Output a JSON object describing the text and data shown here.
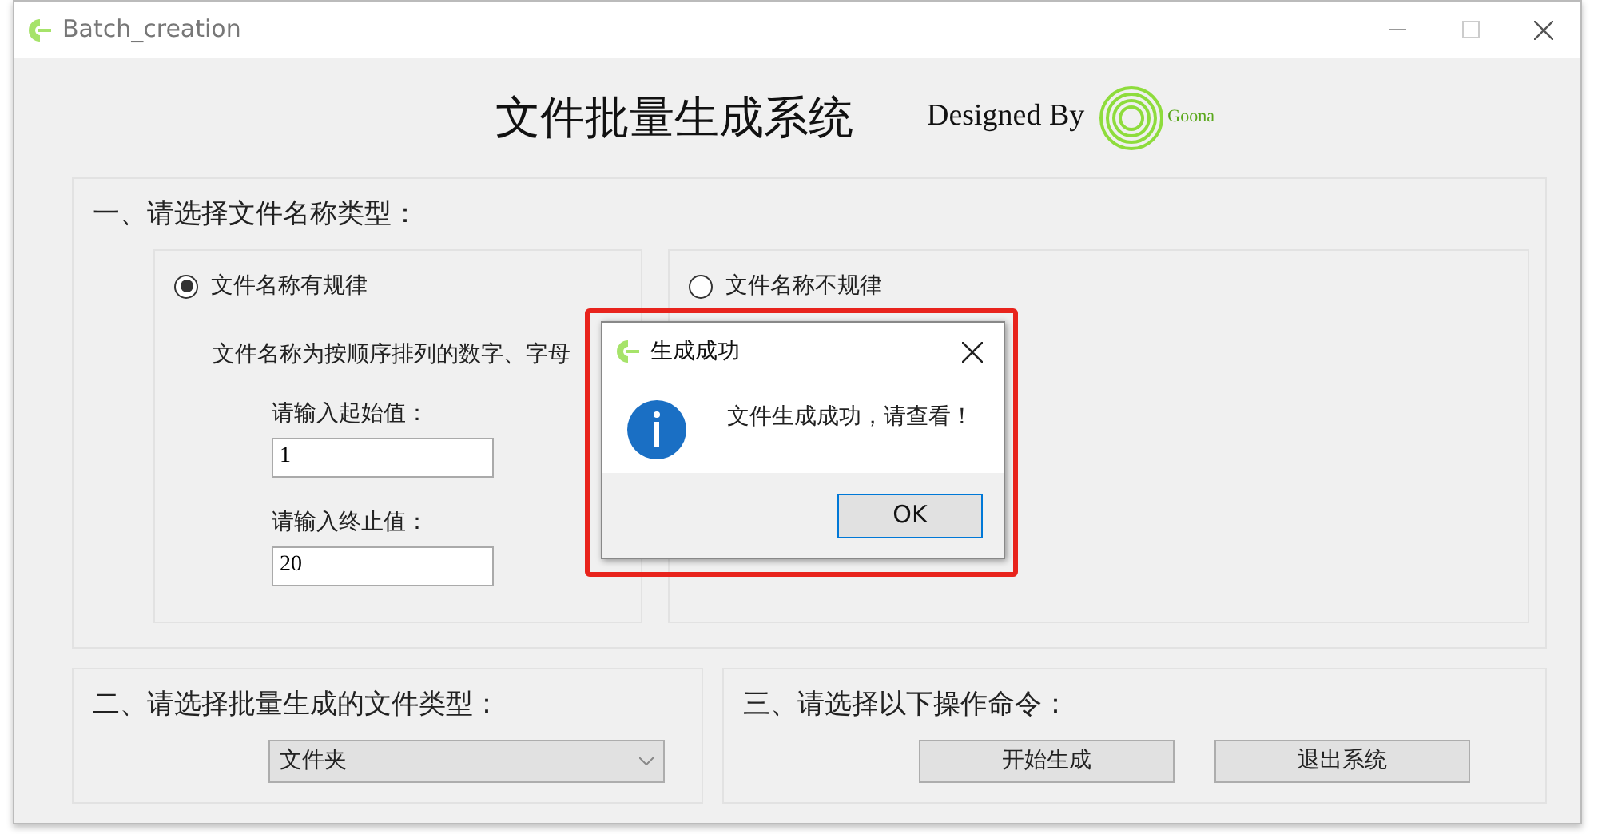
{
  "window": {
    "title": "Batch_creation"
  },
  "header": {
    "title": "文件批量生成系统",
    "designed_by": "Designed By",
    "logo_text": "Goona"
  },
  "section_name_type": {
    "heading": "一、请选择文件名称类型：",
    "options": [
      {
        "label": "文件名称有规律",
        "selected": true,
        "description": "文件名称为按顺序排列的数字、字母",
        "fields": [
          {
            "label": "请输入起始值：",
            "value": "1"
          },
          {
            "label": "请输入终止值：",
            "value": "20"
          }
        ]
      },
      {
        "label": "文件名称不规律",
        "selected": false
      }
    ]
  },
  "section_file_type": {
    "heading": "二、请选择批量生成的文件类型：",
    "dropdown": {
      "value": "文件夹"
    }
  },
  "section_commands": {
    "heading": "三、请选择以下操作命令：",
    "buttons": [
      "开始生成",
      "退出系统"
    ]
  },
  "dialog": {
    "title": "生成成功",
    "message": "文件生成成功，请查看！",
    "button": "OK",
    "highlighted": true
  }
}
